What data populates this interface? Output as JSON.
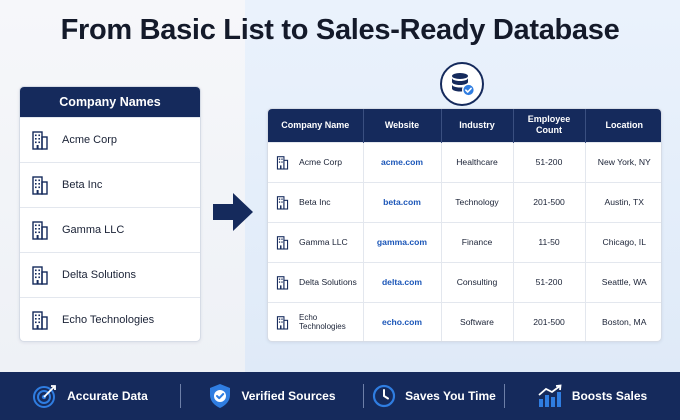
{
  "title": "From Basic List to Sales-Ready Database",
  "list": {
    "header": "Company Names",
    "items": [
      "Acme Corp",
      "Beta Inc",
      "Gamma LLC",
      "Delta Solutions",
      "Echo Technologies"
    ]
  },
  "table": {
    "headers": [
      "Company Name",
      "Website",
      "Industry",
      "Employee Count",
      "Location"
    ],
    "rows": [
      {
        "company": "Acme Corp",
        "website": "acme.com",
        "industry": "Healthcare",
        "employees": "51-200",
        "location": "New York, NY"
      },
      {
        "company": "Beta Inc",
        "website": "beta.com",
        "industry": "Technology",
        "employees": "201-500",
        "location": "Austin, TX"
      },
      {
        "company": "Gamma LLC",
        "website": "gamma.com",
        "industry": "Finance",
        "employees": "11-50",
        "location": "Chicago, IL"
      },
      {
        "company": "Delta Solutions",
        "website": "delta.com",
        "industry": "Consulting",
        "employees": "51-200",
        "location": "Seattle, WA"
      },
      {
        "company": "Echo Technologies",
        "website": "echo.com",
        "industry": "Software",
        "employees": "201-500",
        "location": "Boston, MA"
      }
    ]
  },
  "features": [
    {
      "label": "Accurate Data",
      "icon": "target-icon"
    },
    {
      "label": "Verified Sources",
      "icon": "shield-check-icon"
    },
    {
      "label": "Saves You Time",
      "icon": "clock-icon"
    },
    {
      "label": "Boosts Sales",
      "icon": "growth-chart-icon"
    }
  ],
  "colors": {
    "navy": "#152a5c",
    "accent_blue": "#1b56b8",
    "icon_blue": "#2f7de1"
  }
}
